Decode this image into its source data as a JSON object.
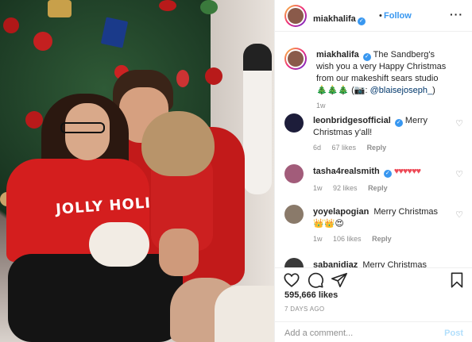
{
  "post": {
    "username": "miakhalifa",
    "follow_label": "Follow",
    "dot": "•",
    "more": "···",
    "photo_sweater_text": "JOLLY HOLIDAY"
  },
  "caption": {
    "username": "miakhalifa",
    "text": "The Sandberg's wish you a very Happy Christmas from our makeshift sears studio 🎄🎄🎄 (📷:",
    "mention": "@blaisejoseph_",
    "mention_suffix": ")",
    "time": "1w"
  },
  "comments": [
    {
      "username": "leonbridgesofficial",
      "verified": true,
      "text": "Merry Christmas y'all!",
      "time": "6d",
      "likes": "67 likes",
      "reply": "Reply"
    },
    {
      "username": "tasha4realsmith",
      "verified": true,
      "text": "♥♥♥♥♥♥",
      "time": "1w",
      "likes": "92 likes",
      "reply": "Reply"
    },
    {
      "username": "yoyelapogian",
      "verified": false,
      "text": "Merry Christmas 👑👑😍",
      "time": "1w",
      "likes": "106 likes",
      "reply": "Reply"
    },
    {
      "username": "sabanidiaz",
      "verified": false,
      "text": "Merry Christmas",
      "time": "",
      "likes": "",
      "reply": ""
    }
  ],
  "actions": {
    "icons": [
      "heart-icon",
      "comment-icon",
      "share-icon",
      "bookmark-icon"
    ]
  },
  "likes": "595,666 likes",
  "date": "7 DAYS AGO",
  "add_comment": {
    "placeholder": "Add a comment...",
    "post_label": "Post"
  },
  "colors": {
    "accent": "#3897f0",
    "heart": "#ed4956",
    "muted": "#8e8e8e"
  }
}
